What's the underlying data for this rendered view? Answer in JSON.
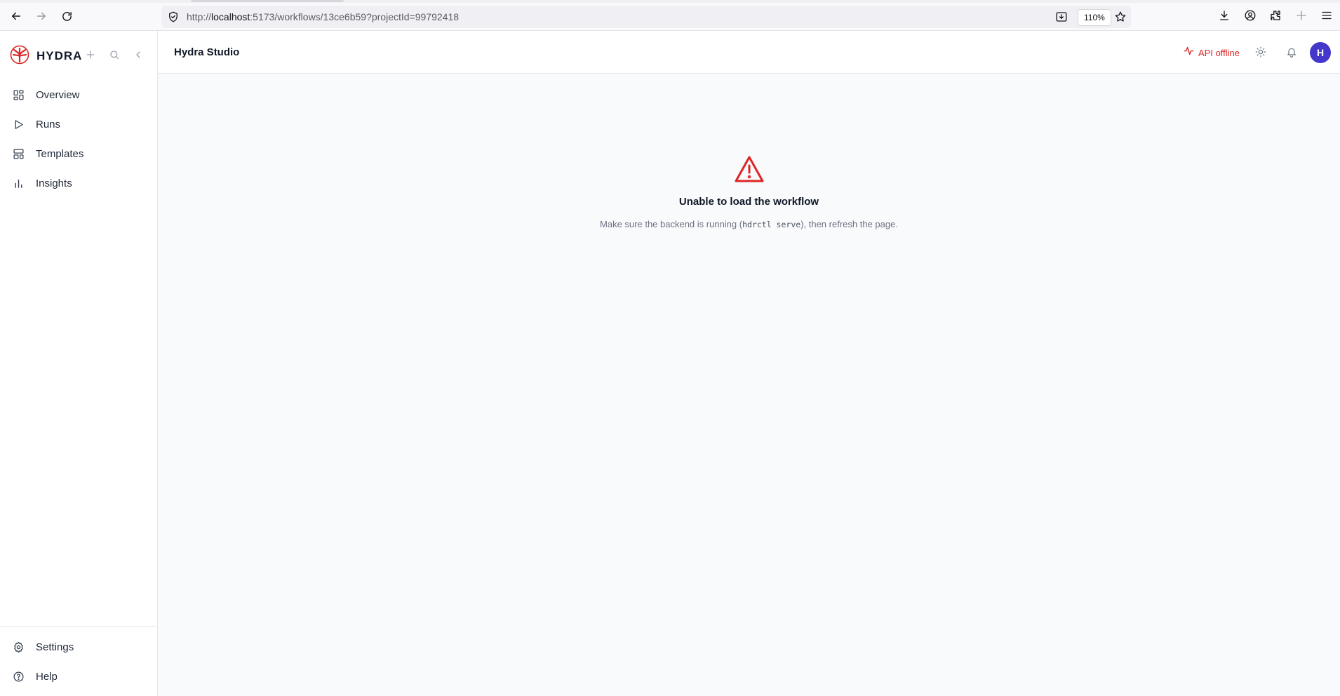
{
  "browser": {
    "url_prefix": "http://",
    "url_host": "localhost",
    "url_rest": ":5173/workflows/13ce6b59?projectId=99792418",
    "zoom": "110%"
  },
  "sidebar": {
    "brand": "HYDRA",
    "nav": [
      {
        "label": "Overview",
        "icon": "grid-icon"
      },
      {
        "label": "Runs",
        "icon": "play-icon"
      },
      {
        "label": "Templates",
        "icon": "layout-icon"
      },
      {
        "label": "Insights",
        "icon": "bar-chart-icon"
      }
    ],
    "bottom": [
      {
        "label": "Settings",
        "icon": "gear-icon"
      },
      {
        "label": "Help",
        "icon": "help-circle-icon"
      }
    ]
  },
  "header": {
    "title": "Hydra Studio",
    "api_status": "API offline",
    "avatar_initial": "H"
  },
  "error": {
    "title": "Unable to load the workflow",
    "msg_before": "Make sure the backend is running (",
    "msg_code": "hdrctl serve",
    "msg_after": "), then refresh the page."
  },
  "colors": {
    "accent": "#4338ca",
    "danger": "#dc2626",
    "brand_red": "#dc2626"
  }
}
